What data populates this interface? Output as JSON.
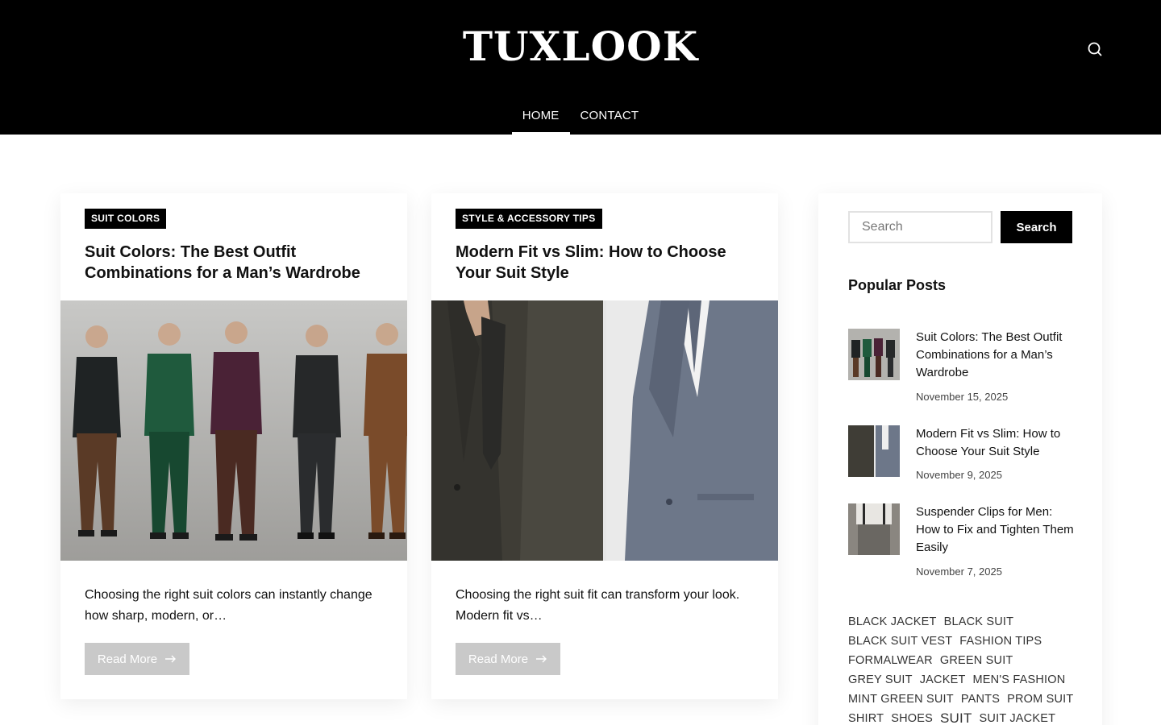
{
  "header": {
    "logo": "TUXLOOK",
    "nav": [
      {
        "label": "HOME",
        "active": true
      },
      {
        "label": "CONTACT",
        "active": false
      }
    ],
    "search_icon": "search-icon"
  },
  "posts": [
    {
      "category": "SUIT COLORS",
      "title": "Suit Colors: The Best Outfit Combinations for a Man’s Wardrobe",
      "excerpt": "Choosing the right suit colors can instantly change how sharp, modern, or…",
      "read_more": "Read More"
    },
    {
      "category": "STYLE & ACCESSORY TIPS",
      "title": "Modern Fit vs Slim: How to Choose Your Suit Style",
      "excerpt": "Choosing the right suit fit can transform your look. Modern fit vs…",
      "read_more": "Read More"
    }
  ],
  "sidebar": {
    "search": {
      "placeholder": "Search",
      "button": "Search"
    },
    "popular_title": "Popular Posts",
    "popular_posts": [
      {
        "title": "Suit Colors: The Best Outfit Combinations for a Man’s Wardrobe",
        "date": "November 15, 2025"
      },
      {
        "title": "Modern Fit vs Slim: How to Choose Your Suit Style",
        "date": "November 9, 2025"
      },
      {
        "title": "Suspender Clips for Men: How to Fix and Tighten Them Easily",
        "date": "November 7, 2025"
      }
    ],
    "tags": [
      "BLACK JACKET",
      "BLACK SUIT",
      "BLACK SUIT VEST",
      "FASHION TIPS",
      "FORMALWEAR",
      "GREEN SUIT",
      "GREY SUIT",
      "JACKET",
      "MEN'S FASHION",
      "MINT GREEN SUIT",
      "PANTS",
      "PROM SUIT",
      "SHIRT",
      "SHOES",
      "SUIT",
      "SUIT JACKET"
    ]
  },
  "colors": {
    "header_bg": "#000000",
    "badge_bg": "#000000",
    "button_disabled": "#c9c9c9"
  }
}
